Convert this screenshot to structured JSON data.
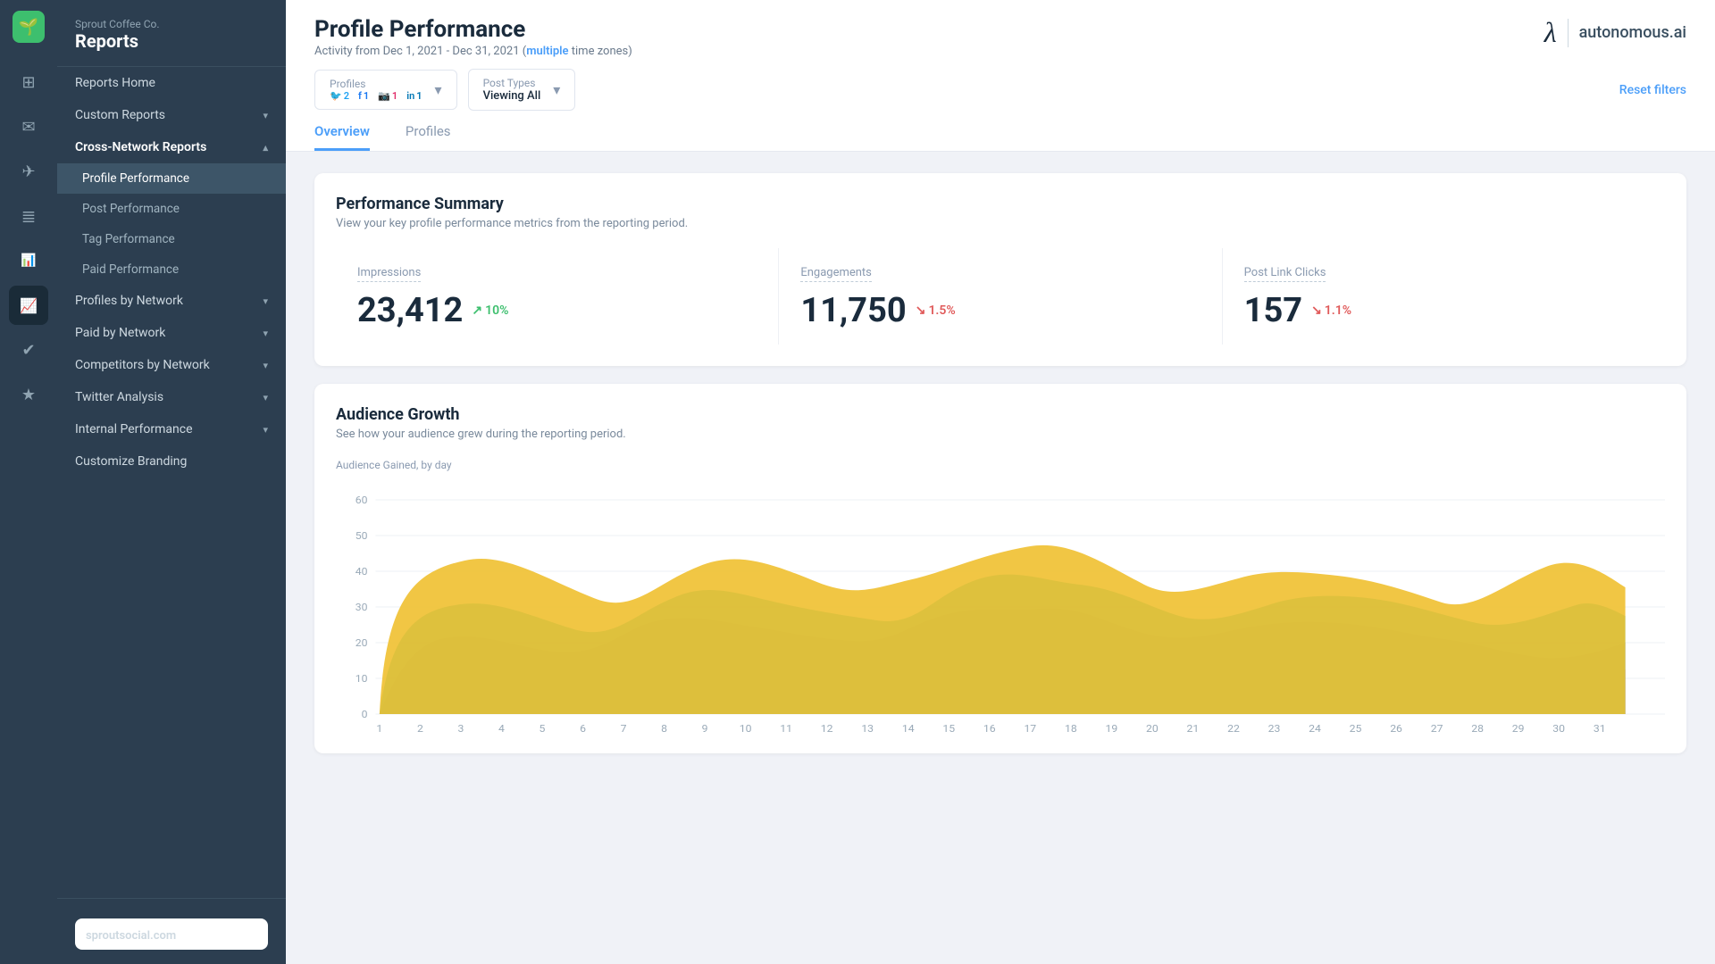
{
  "app": {
    "logo": "🌱",
    "company": "Sprout Coffee Co.",
    "section": "Reports",
    "url": "sproutsocial.com"
  },
  "iconSidebar": {
    "icons": [
      {
        "name": "home-icon",
        "symbol": "⊞",
        "active": false
      },
      {
        "name": "inbox-icon",
        "symbol": "✉",
        "active": false
      },
      {
        "name": "publish-icon",
        "symbol": "✈",
        "active": false
      },
      {
        "name": "listen-icon",
        "symbol": "≡",
        "active": false
      },
      {
        "name": "analytics-icon",
        "symbol": "📊",
        "active": true
      },
      {
        "name": "tasks-icon",
        "symbol": "✔",
        "active": false
      },
      {
        "name": "premium-icon",
        "symbol": "★",
        "active": false
      }
    ]
  },
  "nav": {
    "reportsHome": "Reports Home",
    "customReports": "Custom Reports",
    "crossNetworkReports": "Cross-Network Reports",
    "items": [
      {
        "label": "Profile Performance",
        "active": true
      },
      {
        "label": "Post Performance",
        "active": false
      },
      {
        "label": "Tag Performance",
        "active": false
      },
      {
        "label": "Paid Performance",
        "active": false
      }
    ],
    "profilesByNetwork": "Profiles by Network",
    "paidByNetwork": "Paid by Network",
    "competitorsByNetwork": "Competitors by Network",
    "twitterAnalysis": "Twitter Analysis",
    "internalPerformance": "Internal Performance",
    "customizeBranding": "Customize Branding"
  },
  "header": {
    "title": "Profile Performance",
    "subtitlePrefix": "Activity from Dec 1, 2021 - Dec 31, 2021 (",
    "subtitleHighlight": "multiple",
    "subtitleSuffix": " time zones)",
    "brand": {
      "lambda": "λ",
      "name": "autonomous.ai"
    }
  },
  "filters": {
    "profiles": {
      "label": "Profiles",
      "twitter": {
        "count": 2
      },
      "facebook": {
        "count": 1
      },
      "instagram": {
        "count": 1
      },
      "linkedin": {
        "count": 1
      }
    },
    "postTypes": {
      "label": "Post Types",
      "value": "Viewing All"
    },
    "resetLabel": "Reset filters"
  },
  "tabs": [
    {
      "label": "Overview",
      "active": true
    },
    {
      "label": "Profiles",
      "active": false
    }
  ],
  "performanceSummary": {
    "title": "Performance Summary",
    "subtitle": "View your key profile performance metrics from the reporting period.",
    "metrics": [
      {
        "label": "Impressions",
        "value": "23,412",
        "change": "10%",
        "direction": "up",
        "arrow": "↗"
      },
      {
        "label": "Engagements",
        "value": "11,750",
        "change": "1.5%",
        "direction": "down",
        "arrow": "↘"
      },
      {
        "label": "Post Link Clicks",
        "value": "157",
        "change": "1.1%",
        "direction": "down",
        "arrow": "↘"
      }
    ]
  },
  "audienceGrowth": {
    "title": "Audience Growth",
    "subtitle": "See how your audience grew during the reporting period.",
    "chartLabel": "Audience Gained, by day",
    "yAxis": [
      "60",
      "50",
      "40",
      "30",
      "20",
      "10",
      "0"
    ],
    "xAxis": [
      "1",
      "2",
      "3",
      "4",
      "5",
      "6",
      "7",
      "8",
      "9",
      "10",
      "11",
      "12",
      "13",
      "14",
      "15",
      "16",
      "17",
      "18",
      "19",
      "20",
      "21",
      "22",
      "23",
      "24",
      "25",
      "26",
      "27",
      "28",
      "29",
      "30",
      "31"
    ],
    "colors": {
      "yellow": "#f0c030",
      "teal": "#2abfb0",
      "purple": "#6b4fa0",
      "pink": "#d83a6a"
    }
  }
}
